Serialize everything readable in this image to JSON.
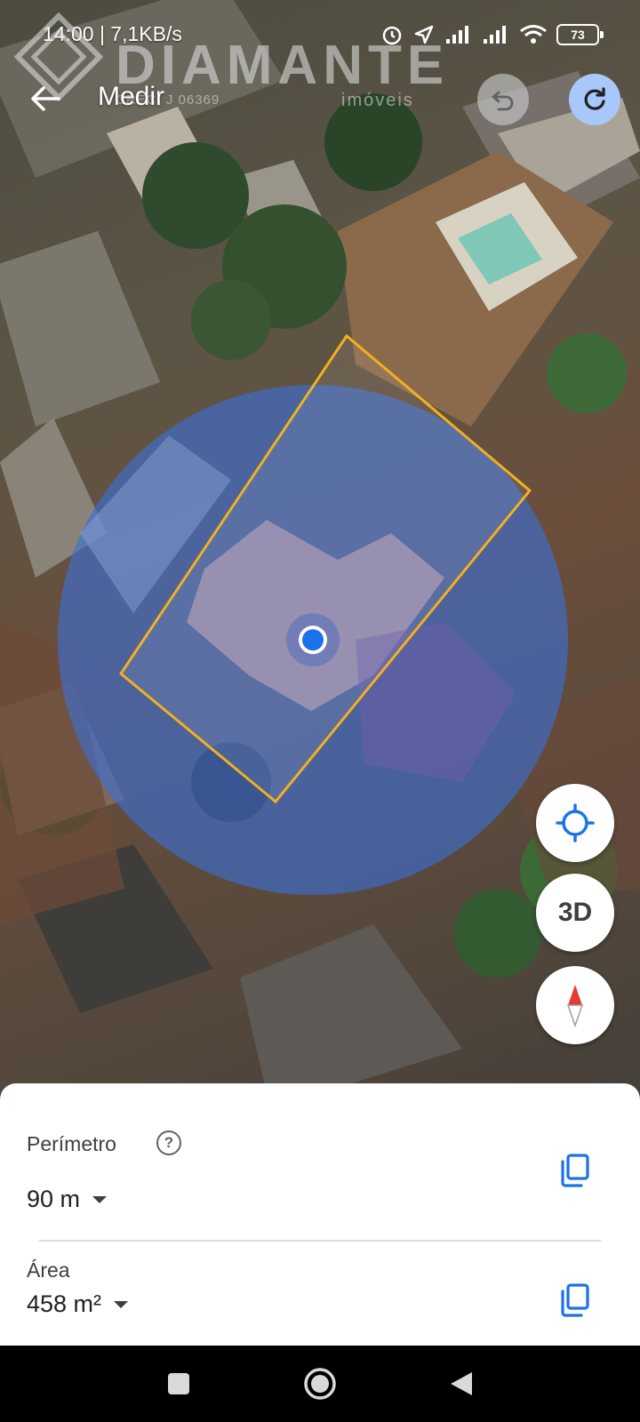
{
  "status_bar": {
    "text": "14:00 | 7,1KB/s",
    "battery": "73"
  },
  "watermark": {
    "name": "DIAMANTE",
    "sub": "imóveis",
    "creci": "CRECI J 06369"
  },
  "header": {
    "title": "Medir"
  },
  "map_controls": {
    "three_d_label": "3D"
  },
  "measurements": {
    "perimeter_label": "Perímetro",
    "perimeter_value": "90 m",
    "area_label": "Área",
    "area_value": "458 m²",
    "help_symbol": "?"
  },
  "colors": {
    "accent_blue": "#1a73e8",
    "polygon_outline": "#f2b01e",
    "redo_bg": "#a8c7fa"
  },
  "icons": [
    "back-arrow-icon",
    "undo-icon",
    "redo-icon",
    "my-location-icon",
    "compass-icon",
    "help-icon",
    "copy-icon",
    "wifi-icon",
    "signal-icon",
    "alarm-icon",
    "navigation-icon"
  ]
}
